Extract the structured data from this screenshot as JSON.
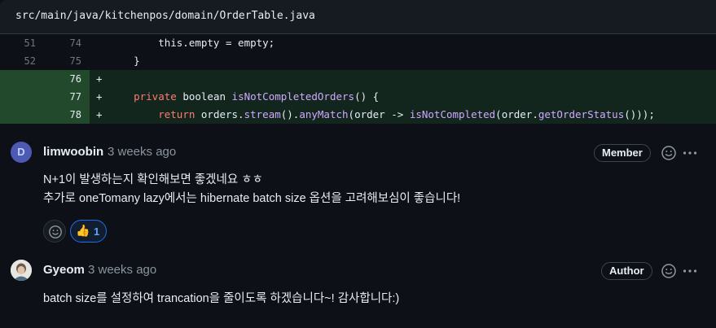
{
  "file": {
    "path": "src/main/java/kitchenpos/domain/OrderTable.java"
  },
  "diff": {
    "rows": [
      {
        "type": "ctx",
        "old": "51",
        "new": "74",
        "code": "        this.empty = empty;"
      },
      {
        "type": "ctx",
        "old": "52",
        "new": "75",
        "code": "    }"
      },
      {
        "type": "add",
        "old": "",
        "new": "76",
        "marker": "+",
        "code": ""
      },
      {
        "type": "add",
        "old": "",
        "new": "77",
        "marker": "+"
      },
      {
        "type": "add",
        "old": "",
        "new": "78",
        "marker": "+"
      }
    ],
    "line77": {
      "kw1": "private",
      "kw2": "boolean",
      "fn": "isNotCompletedOrders",
      "rest": "() {"
    },
    "line78": {
      "kw": "return",
      "t1": "orders.",
      "fn1": "stream",
      "t2": "().",
      "fn2": "anyMatch",
      "t3": "(order -> ",
      "fn3": "isNotCompleted",
      "t4": "(order.",
      "fn4": "getOrderStatus",
      "t5": "()));"
    }
  },
  "comments": [
    {
      "avatar_letter": "D",
      "author": "limwoobin",
      "time": "3 weeks ago",
      "role": "Member",
      "lines": [
        "N+1이 발생하는지 확인해보면 좋겠네요 ㅎㅎ",
        "추가로 oneTomany lazy에서는 hibernate batch size 옵션을 고려해보심이 좋습니다!"
      ],
      "reactions": [
        {
          "emoji": "👍",
          "count": "1"
        }
      ]
    },
    {
      "author": "Gyeom",
      "time": "3 weeks ago",
      "role": "Author",
      "lines": [
        "batch size를 설정하여 trancation을 줄이도록 하겠습니다~! 감사합니다:)"
      ]
    }
  ],
  "colors": {
    "accent": "#1f6feb",
    "add_bg": "#12261e",
    "add_gutter": "#23492d"
  },
  "icons": {
    "smiley": "smiley-icon",
    "more": "kebab-horizontal-icon",
    "add_reaction": "smiley-icon"
  }
}
